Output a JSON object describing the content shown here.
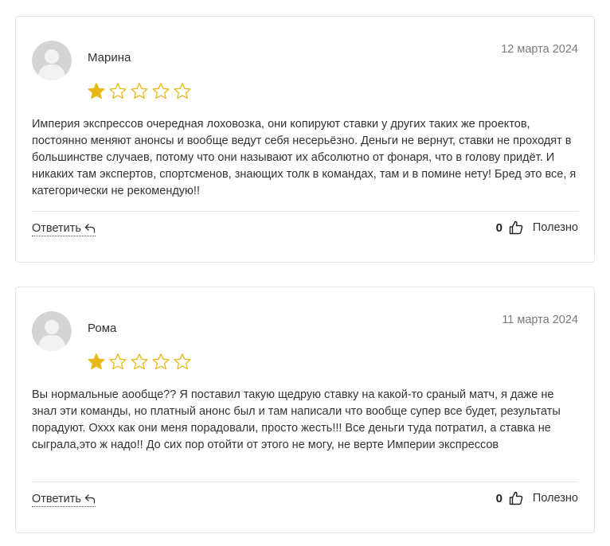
{
  "colors": {
    "star_filled": "#E8B916",
    "star_empty_stroke": "#E8B916",
    "avatar_bg": "#D4D4D4",
    "avatar_fg": "#F2F2F2"
  },
  "reviews": [
    {
      "author": "Марина",
      "date": "12 марта 2024",
      "rating": 1,
      "max_rating": 5,
      "text": "Империя экспрессов очередная лоховозка, они копируют ставки у других таких же проектов, постоянно меняют анонсы и вообще ведут себя несерьёзно. Деньги не вернут, ставки не проходят в большинстве случаев, потому что они называют их абсолютно от фонаря, что в голову придёт. И никаких там экспертов, спортсменов, знающих толк в командах, там и в помине нету! Бред это все, я категорически не рекомендую!!",
      "reply_label": "Ответить",
      "likes": "0",
      "useful_label": "Полезно"
    },
    {
      "author": "Рома",
      "date": "11 марта 2024",
      "rating": 1,
      "max_rating": 5,
      "text": "Вы нормальные аообще?? Я поставил такую щедрую ставку на какой-то сраный матч, я даже не знал эти команды, но платный анонс был и там написали что вообще супер все будет, результаты порадуют. Охxx как они меня порадовали, просто жесть!!! Все деньги туда потратил, а ставка не сыграла,это ж надо!! До сих пор отойти от этого не могу, не верте Империи экспрессов",
      "reply_label": "Ответить",
      "likes": "0",
      "useful_label": "Полезно"
    }
  ]
}
